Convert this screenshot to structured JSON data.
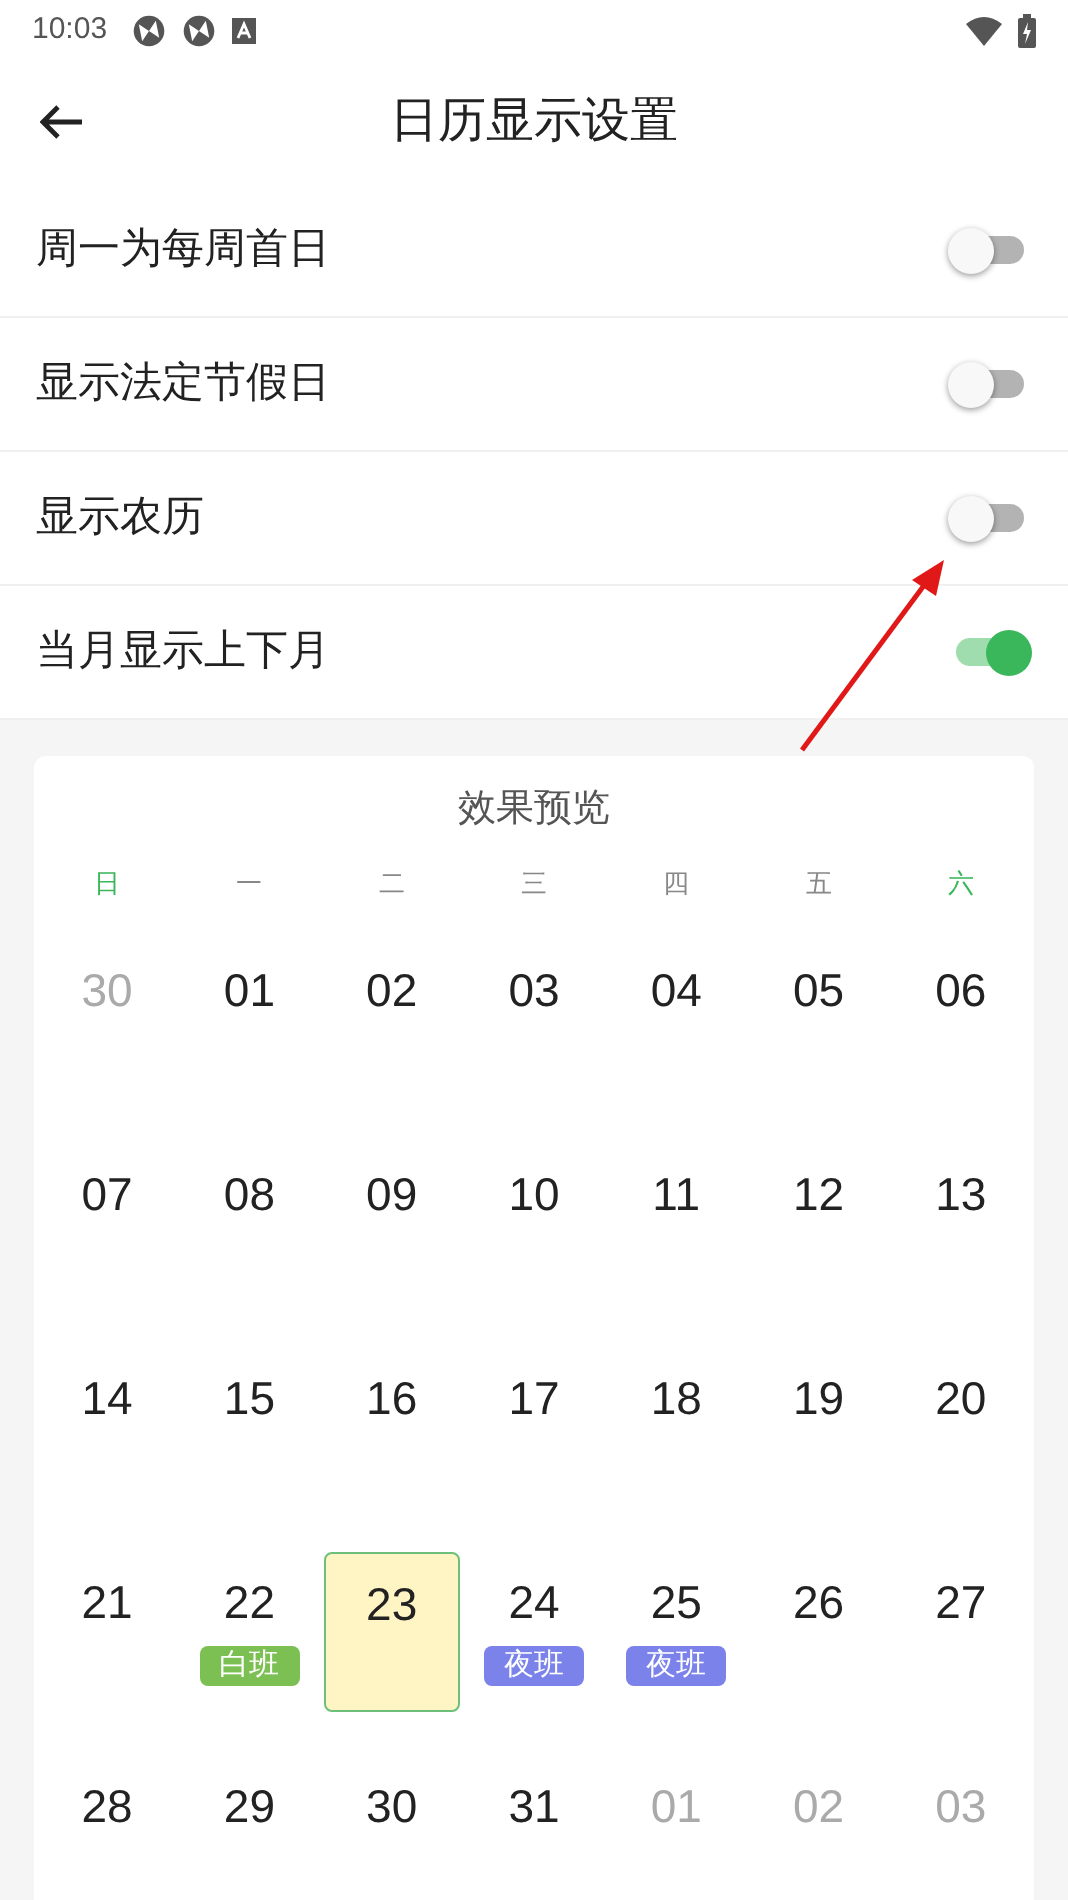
{
  "status_bar": {
    "time": "10:03"
  },
  "header": {
    "title": "日历显示设置"
  },
  "settings": [
    {
      "label": "周一为每周首日",
      "on": false
    },
    {
      "label": "显示法定节假日",
      "on": false
    },
    {
      "label": "显示农历",
      "on": false
    },
    {
      "label": "当月显示上下月",
      "on": true
    }
  ],
  "preview": {
    "title": "效果预览",
    "weekdays": [
      {
        "label": "日",
        "weekend": true
      },
      {
        "label": "一",
        "weekend": false
      },
      {
        "label": "二",
        "weekend": false
      },
      {
        "label": "三",
        "weekend": false
      },
      {
        "label": "四",
        "weekend": false
      },
      {
        "label": "五",
        "weekend": false
      },
      {
        "label": "六",
        "weekend": true
      }
    ],
    "weeks": [
      [
        {
          "day": "30",
          "muted": true,
          "selected": false
        },
        {
          "day": "01",
          "muted": false,
          "selected": false
        },
        {
          "day": "02",
          "muted": false,
          "selected": false
        },
        {
          "day": "03",
          "muted": false,
          "selected": false
        },
        {
          "day": "04",
          "muted": false,
          "selected": false
        },
        {
          "day": "05",
          "muted": false,
          "selected": false
        },
        {
          "day": "06",
          "muted": false,
          "selected": false
        }
      ],
      [
        {
          "day": "07",
          "muted": false,
          "selected": false
        },
        {
          "day": "08",
          "muted": false,
          "selected": false
        },
        {
          "day": "09",
          "muted": false,
          "selected": false
        },
        {
          "day": "10",
          "muted": false,
          "selected": false
        },
        {
          "day": "11",
          "muted": false,
          "selected": false
        },
        {
          "day": "12",
          "muted": false,
          "selected": false
        },
        {
          "day": "13",
          "muted": false,
          "selected": false
        }
      ],
      [
        {
          "day": "14",
          "muted": false,
          "selected": false
        },
        {
          "day": "15",
          "muted": false,
          "selected": false
        },
        {
          "day": "16",
          "muted": false,
          "selected": false
        },
        {
          "day": "17",
          "muted": false,
          "selected": false
        },
        {
          "day": "18",
          "muted": false,
          "selected": false
        },
        {
          "day": "19",
          "muted": false,
          "selected": false
        },
        {
          "day": "20",
          "muted": false,
          "selected": false
        }
      ],
      [
        {
          "day": "21",
          "muted": false,
          "selected": false
        },
        {
          "day": "22",
          "muted": false,
          "selected": false,
          "badge": {
            "text": "白班",
            "color": "#7cc053"
          }
        },
        {
          "day": "23",
          "muted": false,
          "selected": true
        },
        {
          "day": "24",
          "muted": false,
          "selected": false,
          "badge": {
            "text": "夜班",
            "color": "#7b83ea"
          }
        },
        {
          "day": "25",
          "muted": false,
          "selected": false,
          "badge": {
            "text": "夜班",
            "color": "#7b83ea"
          }
        },
        {
          "day": "26",
          "muted": false,
          "selected": false
        },
        {
          "day": "27",
          "muted": false,
          "selected": false
        }
      ],
      [
        {
          "day": "28",
          "muted": false,
          "selected": false
        },
        {
          "day": "29",
          "muted": false,
          "selected": false
        },
        {
          "day": "30",
          "muted": false,
          "selected": false
        },
        {
          "day": "31",
          "muted": false,
          "selected": false
        },
        {
          "day": "01",
          "muted": true,
          "selected": false
        },
        {
          "day": "02",
          "muted": true,
          "selected": false
        },
        {
          "day": "03",
          "muted": true,
          "selected": false
        }
      ]
    ]
  }
}
